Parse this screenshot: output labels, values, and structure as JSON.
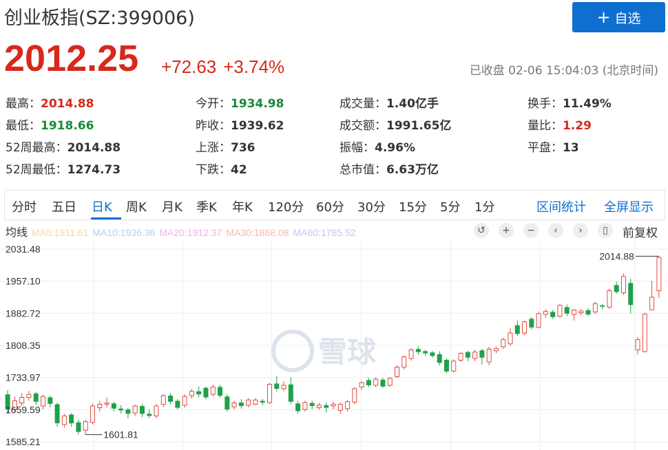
{
  "header": {
    "title": "创业板指(SZ:399006)",
    "watch_button": "自选",
    "watch_icon": "plus-icon",
    "price": "2012.25",
    "change": "+72.63",
    "change_pct": "+3.74%",
    "status": "已收盘 02-06 15:04:03 (北京时间)"
  },
  "stats": [
    {
      "label": "最高：",
      "value": "2014.88",
      "tone": "red"
    },
    {
      "label": "今开：",
      "value": "1934.98",
      "tone": "green"
    },
    {
      "label": "成交量：",
      "value": "1.40亿手",
      "tone": ""
    },
    {
      "label": "换手：",
      "value": "11.49%",
      "tone": ""
    },
    {
      "label": "最低：",
      "value": "1918.66",
      "tone": "green"
    },
    {
      "label": "昨收：",
      "value": "1939.62",
      "tone": ""
    },
    {
      "label": "成交额：",
      "value": "1991.65亿",
      "tone": ""
    },
    {
      "label": "量比：",
      "value": "1.29",
      "tone": "red"
    },
    {
      "label": "52周最高：",
      "value": "2014.88",
      "tone": ""
    },
    {
      "label": "上涨：",
      "value": "736",
      "tone": ""
    },
    {
      "label": "振幅：",
      "value": "4.96%",
      "tone": ""
    },
    {
      "label": "平盘：",
      "value": "13",
      "tone": ""
    },
    {
      "label": "52周最低：",
      "value": "1274.73",
      "tone": ""
    },
    {
      "label": "下跌：",
      "value": "42",
      "tone": ""
    },
    {
      "label": "总市值：",
      "value": "6.63万亿",
      "tone": ""
    }
  ],
  "tabs": [
    "分时",
    "五日",
    "日K",
    "周K",
    "月K",
    "季K",
    "年K",
    "120分",
    "60分",
    "30分",
    "15分",
    "5分",
    "1分"
  ],
  "active_tab": "日K",
  "tab_links": [
    "区间统计",
    "全屏显示"
  ],
  "ma": {
    "label": "均线",
    "items": [
      {
        "text": "MA5:1911.61",
        "color": "#f3d9a0"
      },
      {
        "text": "MA10:1936.36",
        "color": "#a8d4ef"
      },
      {
        "text": "MA20:1912.37",
        "color": "#f2b3e3"
      },
      {
        "text": "MA30:1868.08",
        "color": "#f5b8a6"
      },
      {
        "text": "MA60:1785.52",
        "color": "#cfc0ee"
      }
    ]
  },
  "controls": [
    {
      "name": "reset-icon",
      "glyph": "↺"
    },
    {
      "name": "zoom-in-icon",
      "glyph": "+"
    },
    {
      "name": "zoom-out-icon",
      "glyph": "−"
    },
    {
      "name": "prev-icon",
      "glyph": "‹"
    },
    {
      "name": "next-icon",
      "glyph": "›"
    },
    {
      "name": "candle-type-icon",
      "glyph": "▯"
    }
  ],
  "adjust_label": "前复权",
  "watermark": "雪球",
  "colors": {
    "up": "#e04b3f",
    "down": "#1fa14a",
    "brand": "#0f6fd0"
  },
  "chart_data": {
    "type": "candlestick",
    "y_ticks": [
      "2031.48",
      "1957.10",
      "1882.72",
      "1808.35",
      "1733.97",
      "1659.59",
      "1585.21"
    ],
    "ylim": [
      1585.21,
      2031.48
    ],
    "high_label": "2014.88",
    "low_label": "1601.81",
    "candles": [
      {
        "o": 1695,
        "c": 1660,
        "h": 1705,
        "l": 1650
      },
      {
        "o": 1660,
        "c": 1680,
        "h": 1690,
        "l": 1655
      },
      {
        "o": 1675,
        "c": 1688,
        "h": 1698,
        "l": 1668
      },
      {
        "o": 1688,
        "c": 1695,
        "h": 1703,
        "l": 1680
      },
      {
        "o": 1697,
        "c": 1678,
        "h": 1701,
        "l": 1670
      },
      {
        "o": 1668,
        "c": 1690,
        "h": 1694,
        "l": 1660
      },
      {
        "o": 1688,
        "c": 1673,
        "h": 1692,
        "l": 1665
      },
      {
        "o": 1672,
        "c": 1628,
        "h": 1676,
        "l": 1620
      },
      {
        "o": 1625,
        "c": 1645,
        "h": 1650,
        "l": 1618
      },
      {
        "o": 1648,
        "c": 1628,
        "h": 1652,
        "l": 1620
      },
      {
        "o": 1630,
        "c": 1608,
        "h": 1636,
        "l": 1602
      },
      {
        "o": 1612,
        "c": 1632,
        "h": 1636,
        "l": 1601.81
      },
      {
        "o": 1630,
        "c": 1668,
        "h": 1673,
        "l": 1625
      },
      {
        "o": 1664,
        "c": 1672,
        "h": 1680,
        "l": 1655
      },
      {
        "o": 1672,
        "c": 1675,
        "h": 1688,
        "l": 1665
      },
      {
        "o": 1674,
        "c": 1662,
        "h": 1678,
        "l": 1655
      },
      {
        "o": 1662,
        "c": 1658,
        "h": 1670,
        "l": 1650
      },
      {
        "o": 1660,
        "c": 1650,
        "h": 1663,
        "l": 1640
      },
      {
        "o": 1652,
        "c": 1668,
        "h": 1671,
        "l": 1645
      },
      {
        "o": 1668,
        "c": 1650,
        "h": 1672,
        "l": 1642
      },
      {
        "o": 1650,
        "c": 1645,
        "h": 1660,
        "l": 1640
      },
      {
        "o": 1645,
        "c": 1668,
        "h": 1673,
        "l": 1640
      },
      {
        "o": 1672,
        "c": 1692,
        "h": 1695,
        "l": 1665
      },
      {
        "o": 1692,
        "c": 1678,
        "h": 1698,
        "l": 1672
      },
      {
        "o": 1680,
        "c": 1664,
        "h": 1684,
        "l": 1660
      },
      {
        "o": 1670,
        "c": 1690,
        "h": 1695,
        "l": 1664
      },
      {
        "o": 1692,
        "c": 1702,
        "h": 1708,
        "l": 1685
      },
      {
        "o": 1702,
        "c": 1695,
        "h": 1713,
        "l": 1688
      },
      {
        "o": 1710,
        "c": 1688,
        "h": 1713,
        "l": 1683
      },
      {
        "o": 1695,
        "c": 1712,
        "h": 1717,
        "l": 1690
      },
      {
        "o": 1712,
        "c": 1692,
        "h": 1717,
        "l": 1688
      },
      {
        "o": 1690,
        "c": 1660,
        "h": 1695,
        "l": 1655
      },
      {
        "o": 1666,
        "c": 1675,
        "h": 1680,
        "l": 1660
      },
      {
        "o": 1676,
        "c": 1668,
        "h": 1684,
        "l": 1662
      },
      {
        "o": 1670,
        "c": 1682,
        "h": 1686,
        "l": 1665
      },
      {
        "o": 1672,
        "c": 1682,
        "h": 1686,
        "l": 1670
      },
      {
        "o": 1680,
        "c": 1676,
        "h": 1684,
        "l": 1670
      },
      {
        "o": 1676,
        "c": 1718,
        "h": 1722,
        "l": 1672
      },
      {
        "o": 1720,
        "c": 1708,
        "h": 1738,
        "l": 1702
      },
      {
        "o": 1708,
        "c": 1716,
        "h": 1725,
        "l": 1702
      },
      {
        "o": 1718,
        "c": 1678,
        "h": 1735,
        "l": 1672
      },
      {
        "o": 1674,
        "c": 1656,
        "h": 1680,
        "l": 1650
      },
      {
        "o": 1660,
        "c": 1676,
        "h": 1680,
        "l": 1655
      },
      {
        "o": 1675,
        "c": 1668,
        "h": 1680,
        "l": 1660
      },
      {
        "o": 1664,
        "c": 1670,
        "h": 1675,
        "l": 1660
      },
      {
        "o": 1670,
        "c": 1664,
        "h": 1676,
        "l": 1652
      },
      {
        "o": 1668,
        "c": 1672,
        "h": 1678,
        "l": 1660
      },
      {
        "o": 1658,
        "c": 1672,
        "h": 1676,
        "l": 1650
      },
      {
        "o": 1662,
        "c": 1678,
        "h": 1682,
        "l": 1655
      },
      {
        "o": 1677,
        "c": 1708,
        "h": 1712,
        "l": 1672
      },
      {
        "o": 1712,
        "c": 1722,
        "h": 1726,
        "l": 1705
      },
      {
        "o": 1728,
        "c": 1716,
        "h": 1733,
        "l": 1712
      },
      {
        "o": 1716,
        "c": 1730,
        "h": 1735,
        "l": 1712
      },
      {
        "o": 1729,
        "c": 1713,
        "h": 1733,
        "l": 1710
      },
      {
        "o": 1716,
        "c": 1732,
        "h": 1735,
        "l": 1712
      },
      {
        "o": 1736,
        "c": 1758,
        "h": 1762,
        "l": 1733
      },
      {
        "o": 1758,
        "c": 1782,
        "h": 1785,
        "l": 1752
      },
      {
        "o": 1778,
        "c": 1798,
        "h": 1802,
        "l": 1773
      },
      {
        "o": 1800,
        "c": 1793,
        "h": 1806,
        "l": 1786
      },
      {
        "o": 1795,
        "c": 1790,
        "h": 1798,
        "l": 1784
      },
      {
        "o": 1792,
        "c": 1784,
        "h": 1796,
        "l": 1780
      },
      {
        "o": 1788,
        "c": 1768,
        "h": 1795,
        "l": 1762
      },
      {
        "o": 1775,
        "c": 1748,
        "h": 1778,
        "l": 1744
      },
      {
        "o": 1749,
        "c": 1772,
        "h": 1776,
        "l": 1745
      },
      {
        "o": 1774,
        "c": 1790,
        "h": 1793,
        "l": 1770
      },
      {
        "o": 1793,
        "c": 1780,
        "h": 1796,
        "l": 1772
      },
      {
        "o": 1778,
        "c": 1793,
        "h": 1798,
        "l": 1772
      },
      {
        "o": 1797,
        "c": 1780,
        "h": 1801,
        "l": 1764
      },
      {
        "o": 1770,
        "c": 1800,
        "h": 1805,
        "l": 1762
      },
      {
        "o": 1796,
        "c": 1801,
        "h": 1806,
        "l": 1790
      },
      {
        "o": 1805,
        "c": 1822,
        "h": 1826,
        "l": 1800
      },
      {
        "o": 1812,
        "c": 1837,
        "h": 1848,
        "l": 1808
      },
      {
        "o": 1855,
        "c": 1835,
        "h": 1866,
        "l": 1830
      },
      {
        "o": 1837,
        "c": 1863,
        "h": 1866,
        "l": 1832
      },
      {
        "o": 1870,
        "c": 1850,
        "h": 1874,
        "l": 1845
      },
      {
        "o": 1850,
        "c": 1882,
        "h": 1886,
        "l": 1848
      },
      {
        "o": 1880,
        "c": 1887,
        "h": 1892,
        "l": 1872
      },
      {
        "o": 1886,
        "c": 1874,
        "h": 1890,
        "l": 1869
      },
      {
        "o": 1876,
        "c": 1901,
        "h": 1905,
        "l": 1873
      },
      {
        "o": 1897,
        "c": 1882,
        "h": 1903,
        "l": 1876
      },
      {
        "o": 1880,
        "c": 1890,
        "h": 1893,
        "l": 1866
      },
      {
        "o": 1884,
        "c": 1888,
        "h": 1892,
        "l": 1878
      },
      {
        "o": 1890,
        "c": 1880,
        "h": 1895,
        "l": 1876
      },
      {
        "o": 1886,
        "c": 1905,
        "h": 1910,
        "l": 1881
      },
      {
        "o": 1901,
        "c": 1898,
        "h": 1905,
        "l": 1892
      },
      {
        "o": 1897,
        "c": 1935,
        "h": 1940,
        "l": 1893
      },
      {
        "o": 1948,
        "c": 1932,
        "h": 1956,
        "l": 1928
      },
      {
        "o": 1930,
        "c": 1968,
        "h": 1975,
        "l": 1925
      },
      {
        "o": 1953,
        "c": 1902,
        "h": 1963,
        "l": 1882
      },
      {
        "o": 1798,
        "c": 1822,
        "h": 1828,
        "l": 1788
      },
      {
        "o": 1794,
        "c": 1881,
        "h": 1884,
        "l": 1792
      },
      {
        "o": 1891,
        "c": 1920,
        "h": 1958,
        "l": 1889
      },
      {
        "o": 1934.98,
        "c": 2012.25,
        "h": 2014.88,
        "l": 1918.66
      }
    ]
  }
}
